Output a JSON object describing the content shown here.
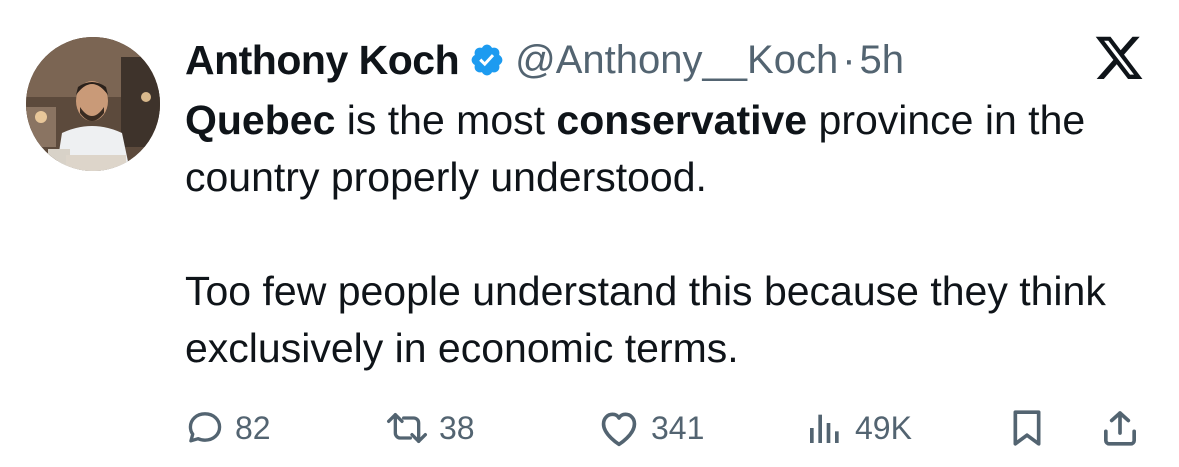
{
  "author": {
    "display_name": "Anthony Koch",
    "handle": "@Anthony__Koch",
    "separator": "·",
    "time": "5h",
    "verified": true
  },
  "platform_icon": "x-logo-icon",
  "tweet": {
    "line1_bold_a": "Quebec",
    "line1_plain_a": " is the most ",
    "line1_bold_b": "conservative",
    "line1_plain_b": " province in the country properly understood.",
    "paragraph2": "Too few people understand this because they think exclusively in economic terms."
  },
  "actions": {
    "reply_count": "82",
    "retweet_count": "38",
    "like_count": "341",
    "views_count": "49K"
  },
  "colors": {
    "text": "#0f1419",
    "muted": "#536471",
    "verified_blue": "#1d9bf0"
  }
}
